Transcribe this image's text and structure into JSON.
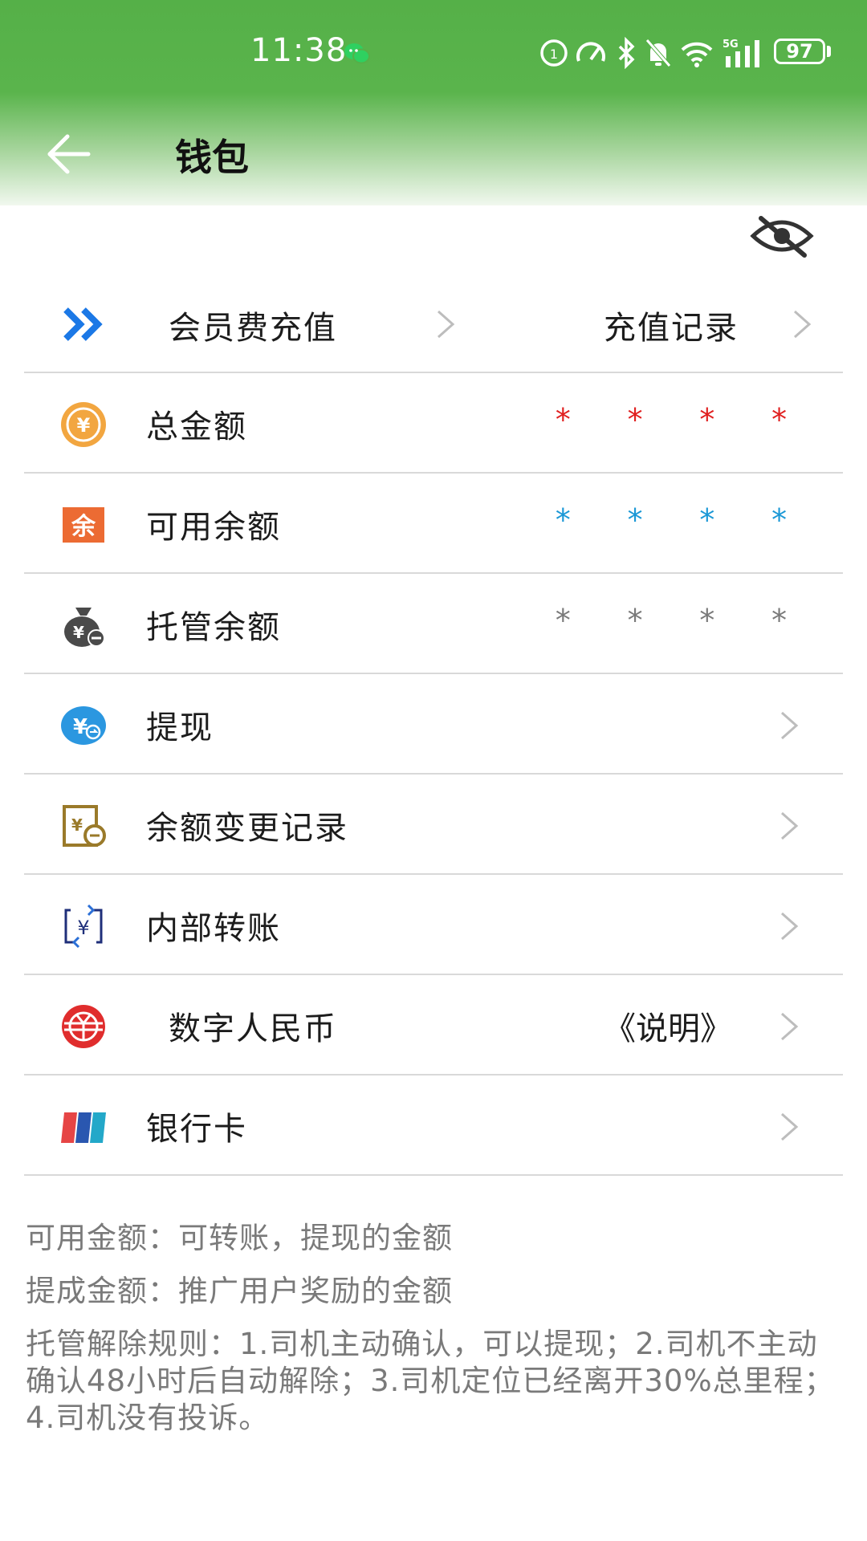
{
  "status_bar": {
    "time": "11:38",
    "battery": "97",
    "network": "5G"
  },
  "header": {
    "title": "钱包"
  },
  "member": {
    "recharge_label": "会员费充值",
    "records_label": "充值记录"
  },
  "rows": [
    {
      "label": "总金额",
      "value": "* * * *",
      "color": "#e02020"
    },
    {
      "label": "可用余额",
      "value": "* * * *",
      "color": "#1b98d6"
    },
    {
      "label": "托管余额",
      "value": "* * * *",
      "color": "#7a7a7a"
    },
    {
      "label": "提现"
    },
    {
      "label": "余额变更记录"
    },
    {
      "label": "内部转账"
    },
    {
      "label": "数字人民币",
      "extra": "《说明》"
    },
    {
      "label": "银行卡"
    }
  ],
  "notes": {
    "available": "可用金额：可转账，提现的金额",
    "commission": "提成金额：推广用户奖励的金额",
    "escrow_rules": "托管解除规则：1.司机主动确认，可以提现；2.司机不主动确认48小时后自动解除；3.司机定位已经离开30%总里程；4.司机没有投诉。"
  },
  "colors": {
    "header_green": "#55b048",
    "accent_blue": "#1b78e6",
    "divider": "#d9d9d9"
  }
}
